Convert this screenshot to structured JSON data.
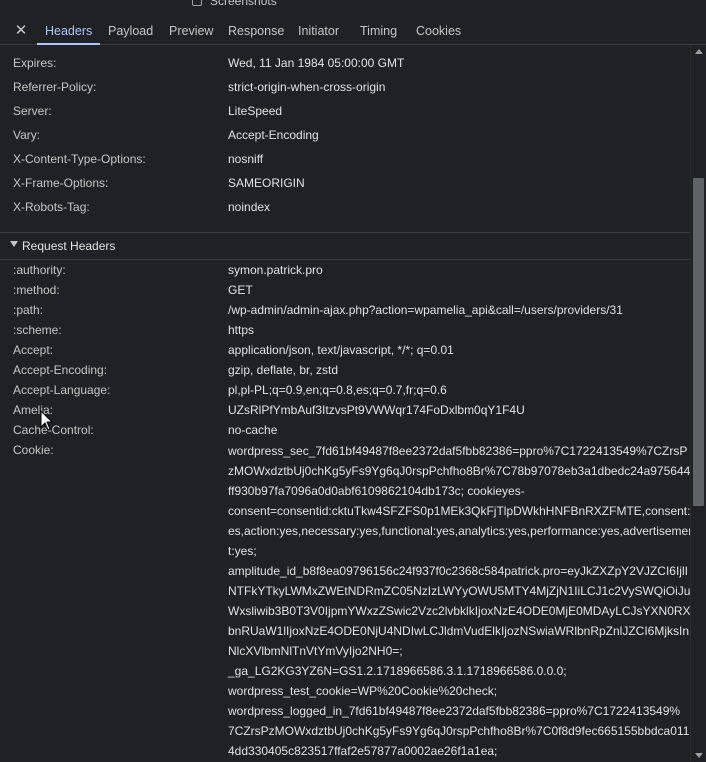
{
  "top": {
    "checkbox_label": "Screenshots"
  },
  "tabs": [
    {
      "label": "Headers",
      "active": true
    },
    {
      "label": "Payload"
    },
    {
      "label": "Preview"
    },
    {
      "label": "Response"
    },
    {
      "label": "Initiator"
    },
    {
      "label": "Timing"
    },
    {
      "label": "Cookies"
    }
  ],
  "response_headers": [
    {
      "name": "Expires:",
      "value": "Wed, 11 Jan 1984 05:00:00 GMT"
    },
    {
      "name": "Referrer-Policy:",
      "value": "strict-origin-when-cross-origin"
    },
    {
      "name": "Server:",
      "value": "LiteSpeed"
    },
    {
      "name": "Vary:",
      "value": "Accept-Encoding"
    },
    {
      "name": "X-Content-Type-Options:",
      "value": "nosniff"
    },
    {
      "name": "X-Frame-Options:",
      "value": "SAMEORIGIN"
    },
    {
      "name": "X-Robots-Tag:",
      "value": "noindex"
    }
  ],
  "request_section": {
    "title": "Request Headers"
  },
  "request_headers": [
    {
      "name": ":authority:",
      "value": "symon.patrick.pro"
    },
    {
      "name": ":method:",
      "value": "GET"
    },
    {
      "name": ":path:",
      "value": "/wp-admin/admin-ajax.php?action=wpamelia_api&call=/users/providers/31"
    },
    {
      "name": ":scheme:",
      "value": "https"
    },
    {
      "name": "Accept:",
      "value": "application/json, text/javascript, */*; q=0.01"
    },
    {
      "name": "Accept-Encoding:",
      "value": "gzip, deflate, br, zstd"
    },
    {
      "name": "Accept-Language:",
      "value": "pl,pl-PL;q=0.9,en;q=0.8,es;q=0.7,fr;q=0.6"
    },
    {
      "name": "Amelia:",
      "value": "UZsRlPfYmbAuf3ItzvsPt9VWWqr174FoDxlbm0qY1F4U"
    },
    {
      "name": "Cache-Control:",
      "value": "no-cache"
    },
    {
      "name": "Cookie:",
      "value": ""
    }
  ],
  "cookie_lines": [
    "wordpress_sec_7fd61bf49487f8ee2372daf5fbb82386=ppro%7C1722413549%7CZrsP",
    "zMOWxdztbUj0chKg5yFs9Yg6qJ0rspPchfho8Br%7C78b97078eb3a1dbedc24a975644",
    "ff930b97fa7096a0d0abf6109862104db173c; cookieyes-",
    "consent=consentid:cktuTkw4SFZFS0p1MEk3QkFjTlpDWkhHNFBnRXZFMTE,consent:y",
    "es,action:yes,necessary:yes,functional:yes,analytics:yes,performance:yes,advertisemen",
    "t:yes;",
    "amplitude_id_b8f8ea09796156c24f937f0c2368c584patrick.pro=eyJkZXZpY2VJZCI6IjlI",
    "NTFkYTkyLWMxZWEtNDRmZC05NzIzLWYyOWU5MTY4MjZjN1IiLCJ1c2VySWQiOiJud",
    "Wxsliwib3B0T3V0IjpmYWxzZSwic2Vzc2lvbklkIjoxNzE4ODE0MjE0MDAyLCJsYXN0RXZl",
    "bnRUaW1lIjoxNzE4ODE0NjU4NDIwLCJldmVudElkIjozNSwiaWRlbnRpZnlJZCI6MjksIn",
    "NlcXVlbmNlTnVtYmVyIjo2NH0=;",
    "_ga_LG2KG3YZ6N=GS1.2.1718966586.3.1.1718966586.0.0.0;",
    "wordpress_test_cookie=WP%20Cookie%20check;",
    "wordpress_logged_in_7fd61bf49487f8ee2372daf5fbb82386=ppro%7C1722413549%",
    "7CZrsPzMOWxdztbUj0chKg5yFs9Yg6qJ0rspPchfho8Br%7C0f8d9fec665155bbdca011",
    "4dd330405c823517ffaf2e57877a0002ae26f1a1ea;"
  ]
}
